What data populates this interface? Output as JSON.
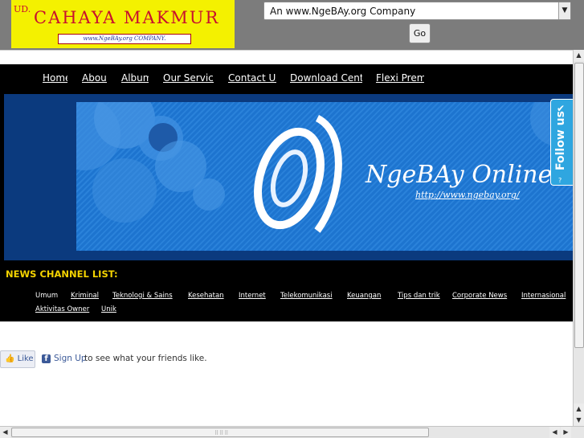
{
  "logo": {
    "prefix": "UD.",
    "name": "CAHAYA  MAKMUR",
    "tagline": "www.NgeBAy.org COMPANY."
  },
  "header": {
    "select_value": "An www.NgeBAy.org Company",
    "go_label": "Go"
  },
  "nav": {
    "items": [
      {
        "label": "Home"
      },
      {
        "label": "About"
      },
      {
        "label": "Album"
      },
      {
        "label": "Our Service"
      },
      {
        "label": "Contact Us"
      },
      {
        "label": "Download Center"
      },
      {
        "label": "Flexi Premi"
      }
    ]
  },
  "banner": {
    "brand": "NgeBAy Online",
    "url": "http://www.ngebay.org/"
  },
  "follow": {
    "label": "Follow us",
    "help": "?"
  },
  "news": {
    "title": "NEWS CHANNEL LIST:",
    "items": [
      {
        "label": "Umum"
      },
      {
        "label": "Kriminal"
      },
      {
        "label": "Teknologi & Sains"
      },
      {
        "label": "Kesehatan"
      },
      {
        "label": "Internet"
      },
      {
        "label": "Telekomunikasi"
      },
      {
        "label": "Keuangan"
      },
      {
        "label": "Tips dan trik"
      },
      {
        "label": "Corporate News"
      },
      {
        "label": "Internasional"
      },
      {
        "label": "Aktivitas Owner"
      },
      {
        "label": "Unik"
      }
    ]
  },
  "facebook": {
    "like_label": "Like",
    "signup_label": "Sign Up",
    "rest_text": "to see what your friends like."
  },
  "colors": {
    "logo_bg": "#f4f100",
    "logo_text": "#c8102e",
    "nav_bg": "#000000",
    "news_title": "#f4d300",
    "banner_blue": "#1d74cf",
    "follow_bg": "#2fa6e0"
  },
  "icons": {
    "select_arrow": "chevron-down-icon",
    "follow_bird": "twitter-bird-icon",
    "fb_like": "thumbs-up-icon",
    "fb_logo": "facebook-icon"
  }
}
